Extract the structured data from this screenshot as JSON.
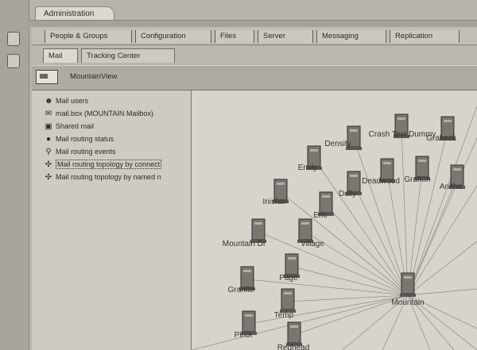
{
  "window": {
    "title": "Administration"
  },
  "tabs": [
    "People & Groups",
    "Configuration",
    "Files",
    "Server",
    "Messaging",
    "Replication"
  ],
  "subtabs": [
    "Mail",
    "Tracking Center"
  ],
  "domain": {
    "label": "MountainView"
  },
  "nav": {
    "items": [
      {
        "label": "Mail users",
        "icon": "mail-users-icon"
      },
      {
        "label": "mail.box (MOUNTAIN Mailbox)",
        "icon": "mailbox-icon"
      },
      {
        "label": "Shared mail",
        "icon": "shared-mail-icon"
      },
      {
        "label": "Mail routing status",
        "icon": "routing-status-icon"
      },
      {
        "label": "Mail routing events",
        "icon": "routing-events-icon"
      },
      {
        "label": "Mail routing topology by connect",
        "icon": "topology-icon",
        "selected": true
      },
      {
        "label": "Mail routing topology by named n",
        "icon": "topology-named-icon"
      }
    ]
  },
  "graph": {
    "hub": "Mountain",
    "servers": [
      "Density",
      "Crash Test Dummy",
      "Grabeck",
      "Emily",
      "Deadwood",
      "Grafton",
      "Anitha",
      "Dolly",
      "Inisfax",
      "Eric",
      "Mountain Dr",
      "Village",
      "Page",
      "Granite",
      "Temp",
      "Pinot",
      "Redhead"
    ]
  },
  "colors": {
    "background": "#b9b4ab",
    "pane": "#d8d4cc",
    "server": "#7a7771"
  }
}
